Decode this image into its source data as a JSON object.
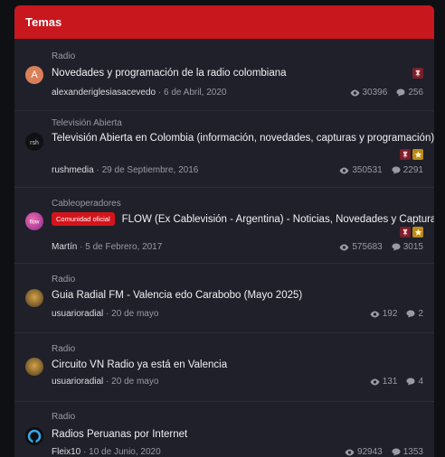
{
  "header": {
    "title": "Temas"
  },
  "topics": [
    {
      "category": "Radio",
      "title": "Novedades y programación de la radio colombiana",
      "author": "alexanderiglesiasacevedo",
      "date": "6 de Abril, 2020",
      "views": "30396",
      "replies": "256",
      "avatar_letter": "A"
    },
    {
      "category": "Televisión Abierta",
      "title": "Televisión Abierta en Colombia (información, novedades, capturas y programación)",
      "author": "rushmedia",
      "date": "29 de Septiembre, 2016",
      "views": "350531",
      "replies": "2291"
    },
    {
      "category": "Cableoperadores",
      "badge": "Comunidad oficial",
      "title": "FLOW (Ex Cablevisión - Argentina) - Noticias, Novedades y Capturas",
      "author": "Martín",
      "date": "5 de Febrero, 2017",
      "views": "575683",
      "replies": "3015"
    },
    {
      "category": "Radio",
      "title": "Guia Radial FM - Valencia edo Carabobo (Mayo 2025)",
      "author": "usuarioradial",
      "date": "20 de mayo",
      "views": "192",
      "replies": "2"
    },
    {
      "category": "Radio",
      "title": "Circuito VN Radio ya está en Valencia",
      "author": "usuarioradial",
      "date": "20 de mayo",
      "views": "131",
      "replies": "4"
    },
    {
      "category": "Radio",
      "title": "Radios Peruanas por Internet",
      "author": "Fleix10",
      "date": "10 de Junio, 2020",
      "views": "92943",
      "replies": "1353"
    }
  ],
  "separator": "·",
  "colors": {
    "accent": "#c8181e",
    "panel": "#1f2029",
    "pin_badge": "#7a1f2a",
    "star_badge": "#b98a1a"
  },
  "icons": {
    "views": "eye-icon",
    "replies": "comment-icon",
    "pinned": "pin-icon",
    "featured": "star-icon"
  }
}
